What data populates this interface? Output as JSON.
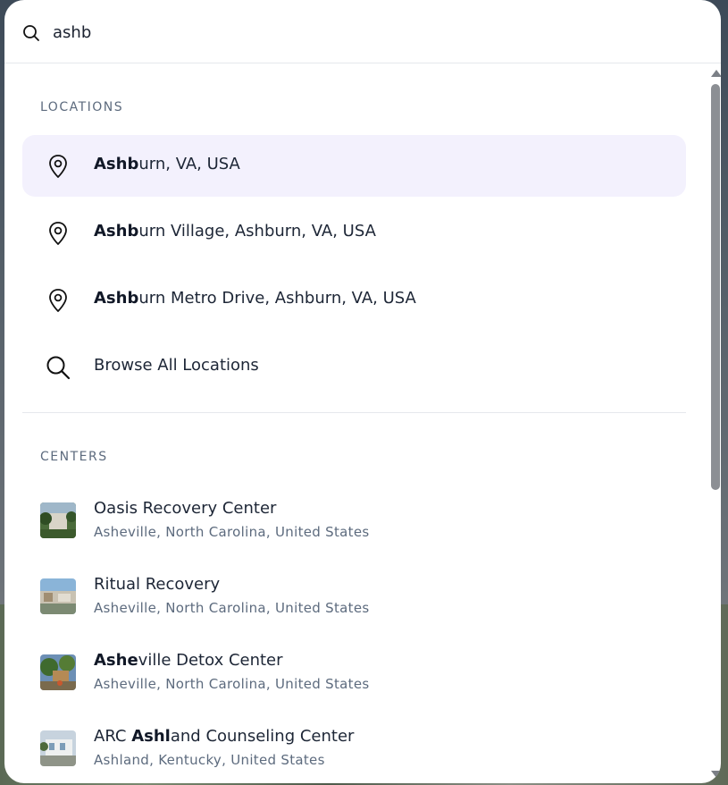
{
  "search": {
    "value": "ashb",
    "icon": "search-icon"
  },
  "locations": {
    "heading": "LOCATIONS",
    "items": [
      {
        "bold": "Ashb",
        "rest": "urn, VA, USA",
        "icon": "map-pin-icon",
        "active": true
      },
      {
        "bold": "Ashb",
        "rest": "urn Village, Ashburn, VA, USA",
        "icon": "map-pin-icon"
      },
      {
        "bold": "Ashb",
        "rest": "urn Metro Drive, Ashburn, VA, USA",
        "icon": "map-pin-icon"
      },
      {
        "bold": "",
        "rest": "Browse All Locations",
        "icon": "search-icon"
      }
    ]
  },
  "centers": {
    "heading": "CENTERS",
    "items": [
      {
        "pre": "",
        "bold": "",
        "post": "Oasis Recovery Center",
        "location": "Asheville, North Carolina, United States"
      },
      {
        "pre": "",
        "bold": "",
        "post": "Ritual Recovery",
        "location": "Asheville, North Carolina, United States"
      },
      {
        "pre": "",
        "bold": "Ashe",
        "post": "ville Detox Center",
        "location": "Asheville, North Carolina, United States"
      },
      {
        "pre": "ARC ",
        "bold": "Ashl",
        "post": "and Counseling Center",
        "location": "Ashland, Kentucky, United States"
      }
    ]
  },
  "colors": {
    "active_row": "#f3f1fd",
    "text": "#1d2636",
    "muted": "#5d6b7e"
  }
}
